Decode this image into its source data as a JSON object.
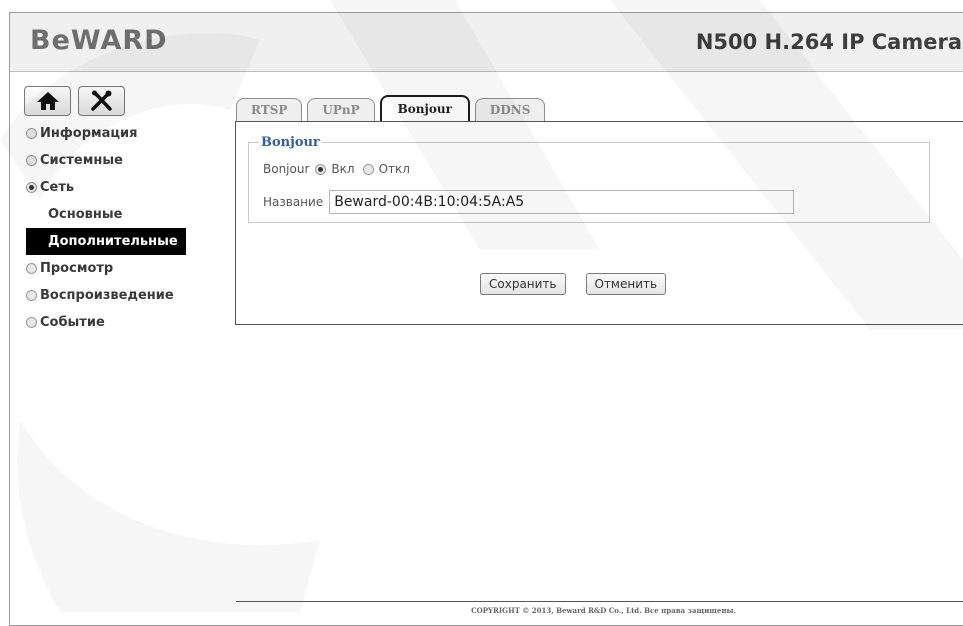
{
  "header": {
    "logo": "BeWARD",
    "model": "N500 H.264 IP Camera"
  },
  "sidebar": {
    "top_buttons": [
      {
        "icon": "home-icon"
      },
      {
        "icon": "tools-icon"
      }
    ],
    "menu": [
      {
        "label": "Информация",
        "radio": "off"
      },
      {
        "label": "Системные",
        "radio": "off"
      },
      {
        "label": "Сеть",
        "radio": "on"
      },
      {
        "label": "Основные",
        "sub": true
      },
      {
        "label": "Дополнительные",
        "sub": true,
        "active": true
      },
      {
        "label": "Просмотр",
        "radio": "off"
      },
      {
        "label": "Воспроизведение",
        "radio": "off"
      },
      {
        "label": "Событие",
        "radio": "off"
      }
    ]
  },
  "tabs": [
    {
      "label": "RTSP",
      "active": false
    },
    {
      "label": "UPnP",
      "active": false
    },
    {
      "label": "Bonjour",
      "active": true
    },
    {
      "label": "DDNS",
      "active": false
    }
  ],
  "bonjour": {
    "legend": "Bonjour",
    "field_label": "Bonjour",
    "option_on": "Вкл",
    "option_off": "Откл",
    "selected": "on",
    "name_label": "Название",
    "name_value": "Beward-00:4B:10:04:5A:A5"
  },
  "actions": {
    "save": "Сохранить",
    "cancel": "Отменить"
  },
  "footer": "COPYRIGHT © 2013, Beward R&D Co., Ltd. Все права защищены.",
  "colors": {
    "legend": "#2b5eab",
    "active_menu_bg": "#000000"
  }
}
